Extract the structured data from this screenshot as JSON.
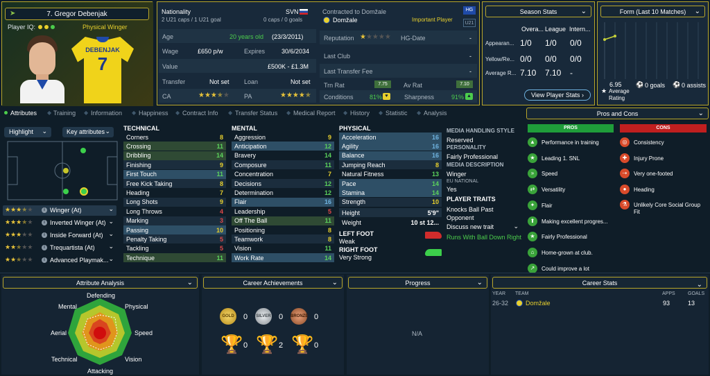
{
  "player": {
    "name": "7. Gregor Debenjak",
    "player_iq_label": "Player IQ:",
    "role_label": "Physical Winger",
    "shirt_name": "DEBENJAK",
    "shirt_number": "7"
  },
  "info": {
    "nationality_label": "Nationality",
    "nationality": "SVN",
    "caps": "2 U21 caps / 1 U21 goal",
    "caps2": "0 caps / 0 goals",
    "contract_label": "Contracted to Domžale",
    "club": "Domžale",
    "importance": "Important Player",
    "badge1": "HG",
    "badge2": "U21",
    "age_label": "Age",
    "age": "20 years old",
    "dob": "(23/3/2011)",
    "wage_label": "Wage",
    "wage": "£650 p/w",
    "expires_label": "Expires",
    "expires": "30/6/2034",
    "value_label": "Value",
    "value": "£500K - £1.3M",
    "transfer_label": "Transfer",
    "transfer": "Not set",
    "loan_label": "Loan",
    "loan": "Not set",
    "ca_label": "CA",
    "pa_label": "PA",
    "reputation_label": "Reputation",
    "hg_label": "HG-Date",
    "hg_value": "-",
    "last_club_label": "Last Club",
    "last_club": "-",
    "last_fee_label": "Last Transfer Fee",
    "last_fee": "-",
    "trn_label": "Trn Rat",
    "trn": "7.75",
    "av_label": "Av Rat",
    "av": "7.10",
    "cond_label": "Conditions",
    "cond": "81%",
    "sharp_label": "Sharpness",
    "sharp": "91%"
  },
  "season": {
    "title": "Season Stats",
    "cols": [
      "Overa...",
      "League",
      "Intern..."
    ],
    "rows": [
      {
        "label": "Appearan...",
        "v": [
          "1/0",
          "1/0",
          "0/0"
        ]
      },
      {
        "label": "Yellow/Re...",
        "v": [
          "0/0",
          "0/0",
          "0/0"
        ]
      },
      {
        "label": "Average R...",
        "v": [
          "7.10",
          "7.10",
          "-"
        ]
      }
    ],
    "button": "View Player Stats"
  },
  "form": {
    "title": "Form (Last 10 Matches)",
    "rating": "6.95",
    "rating_label": "Average Rating",
    "goals": "0 goals",
    "assists": "0 assists"
  },
  "tabs": [
    "Attributes",
    "Training",
    "Information",
    "Happiness",
    "Contract Info",
    "Transfer Status",
    "Medical Report",
    "History",
    "Statistic",
    "Analysis"
  ],
  "highlight": {
    "label": "Highlight",
    "key": "Key attributes"
  },
  "roles": [
    {
      "label": "Winger (At)",
      "stars": 3.5
    },
    {
      "label": "Inverted Winger (At)",
      "stars": 3.5
    },
    {
      "label": "Inside Forward (At)",
      "stars": 3
    },
    {
      "label": "Trequartista (At)",
      "stars": 2.5
    },
    {
      "label": "Advanced Playmak...",
      "stars": 2.5
    }
  ],
  "technical": {
    "title": "TECHNICAL",
    "items": [
      {
        "name": "Corners",
        "v": "8",
        "c": "y"
      },
      {
        "name": "Crossing",
        "v": "11",
        "c": "g",
        "hl": "g"
      },
      {
        "name": "Dribbling",
        "v": "14",
        "c": "g",
        "hl": "g"
      },
      {
        "name": "Finishing",
        "v": "9",
        "c": "y"
      },
      {
        "name": "First Touch",
        "v": "11",
        "c": "g",
        "hl": "b"
      },
      {
        "name": "Free Kick Taking",
        "v": "8",
        "c": "y"
      },
      {
        "name": "Heading",
        "v": "7",
        "c": "y"
      },
      {
        "name": "Long Shots",
        "v": "9",
        "c": "y"
      },
      {
        "name": "Long Throws",
        "v": "4",
        "c": "r"
      },
      {
        "name": "Marking",
        "v": "3",
        "c": "r"
      },
      {
        "name": "Passing",
        "v": "10",
        "c": "y",
        "hl": "b"
      },
      {
        "name": "Penalty Taking",
        "v": "5",
        "c": "r"
      },
      {
        "name": "Tackling",
        "v": "5",
        "c": "r"
      },
      {
        "name": "Technique",
        "v": "11",
        "c": "g",
        "hl": "g"
      }
    ]
  },
  "mental": {
    "title": "MENTAL",
    "items": [
      {
        "name": "Aggression",
        "v": "9",
        "c": "y"
      },
      {
        "name": "Anticipation",
        "v": "12",
        "c": "g",
        "hl": "b"
      },
      {
        "name": "Bravery",
        "v": "14",
        "c": "g"
      },
      {
        "name": "Composure",
        "v": "11",
        "c": "g"
      },
      {
        "name": "Concentration",
        "v": "7",
        "c": "y"
      },
      {
        "name": "Decisions",
        "v": "12",
        "c": "g"
      },
      {
        "name": "Determination",
        "v": "12",
        "c": "g"
      },
      {
        "name": "Flair",
        "v": "16",
        "c": "b",
        "hl": "b"
      },
      {
        "name": "Leadership",
        "v": "5",
        "c": "r"
      },
      {
        "name": "Off The Ball",
        "v": "11",
        "c": "g",
        "hl": "g"
      },
      {
        "name": "Positioning",
        "v": "8",
        "c": "y"
      },
      {
        "name": "Teamwork",
        "v": "8",
        "c": "y"
      },
      {
        "name": "Vision",
        "v": "11",
        "c": "g"
      },
      {
        "name": "Work Rate",
        "v": "14",
        "c": "g",
        "hl": "b"
      }
    ]
  },
  "physical": {
    "title": "PHYSICAL",
    "items": [
      {
        "name": "Acceleration",
        "v": "16",
        "c": "b",
        "hl": "b"
      },
      {
        "name": "Agility",
        "v": "16",
        "c": "b",
        "hl": "b"
      },
      {
        "name": "Balance",
        "v": "16",
        "c": "b",
        "hl": "b"
      },
      {
        "name": "Jumping Reach",
        "v": "8",
        "c": "y"
      },
      {
        "name": "Natural Fitness",
        "v": "13",
        "c": "g"
      },
      {
        "name": "Pace",
        "v": "14",
        "c": "g",
        "hl": "b"
      },
      {
        "name": "Stamina",
        "v": "14",
        "c": "g",
        "hl": "b"
      },
      {
        "name": "Strength",
        "v": "10",
        "c": "y"
      }
    ],
    "height_label": "Height",
    "height": "5'9\"",
    "weight_label": "Weight",
    "weight": "10 st 12...",
    "left_foot_label": "LEFT FOOT",
    "left_foot": "Weak",
    "right_foot_label": "RIGHT FOOT",
    "right_foot": "Very Strong"
  },
  "media": {
    "mhs_label": "MEDIA HANDLING STYLE",
    "mhs": "Reserved",
    "pers_label": "PERSONALITY",
    "pers": "Fairly Professional",
    "desc_label": "MEDIA DESCRIPTION",
    "desc": "Winger",
    "eu_label": "EU NATIONAL",
    "eu": "Yes",
    "traits_label": "PLAYER TRAITS",
    "trait1": "Knocks Ball Past Opponent",
    "discuss": "Discuss new trait",
    "trait2": "Runs With Ball Down Right"
  },
  "proscons": {
    "title": "Pros and Cons",
    "pros_label": "PROS",
    "cons_label": "CONS",
    "pros": [
      "Performance in training",
      "Leading 1. SNL",
      "Speed",
      "Versatility",
      "Flair",
      "Making excellent progres...",
      "Fairly Professional",
      "Home-grown at club.",
      "Could improve a lot"
    ],
    "cons": [
      "Consistency",
      "Injury Prone",
      "Very one-footed",
      "Heading",
      "Unlikely Core Social Group Fit"
    ]
  },
  "bottom": {
    "analysis_title": "Attribute Analysis",
    "radar_labels": [
      "Defending",
      "Physical",
      "Speed",
      "Vision",
      "Attacking",
      "Technical",
      "Aerial",
      "Mental"
    ],
    "achievements_title": "Career Achievements",
    "medals": [
      "GOLD",
      "SILVER",
      "BRONZE"
    ],
    "medal_counts": [
      "0",
      "0",
      "0"
    ],
    "trophy_counts": [
      "0",
      "2",
      "0"
    ],
    "progress_title": "Progress",
    "progress_na": "N/A",
    "career_title": "Career Stats",
    "career_cols": [
      "YEAR",
      "TEAM",
      "APPS",
      "GOALS"
    ],
    "career_row": {
      "year": "26-32",
      "team": "Domžale",
      "apps": "93",
      "goals": "13"
    }
  },
  "colors": {
    "gold": "#b9a62a",
    "pros": "#1f9d3a",
    "cons": "#c01f1f",
    "green": "#4ccd4c"
  }
}
